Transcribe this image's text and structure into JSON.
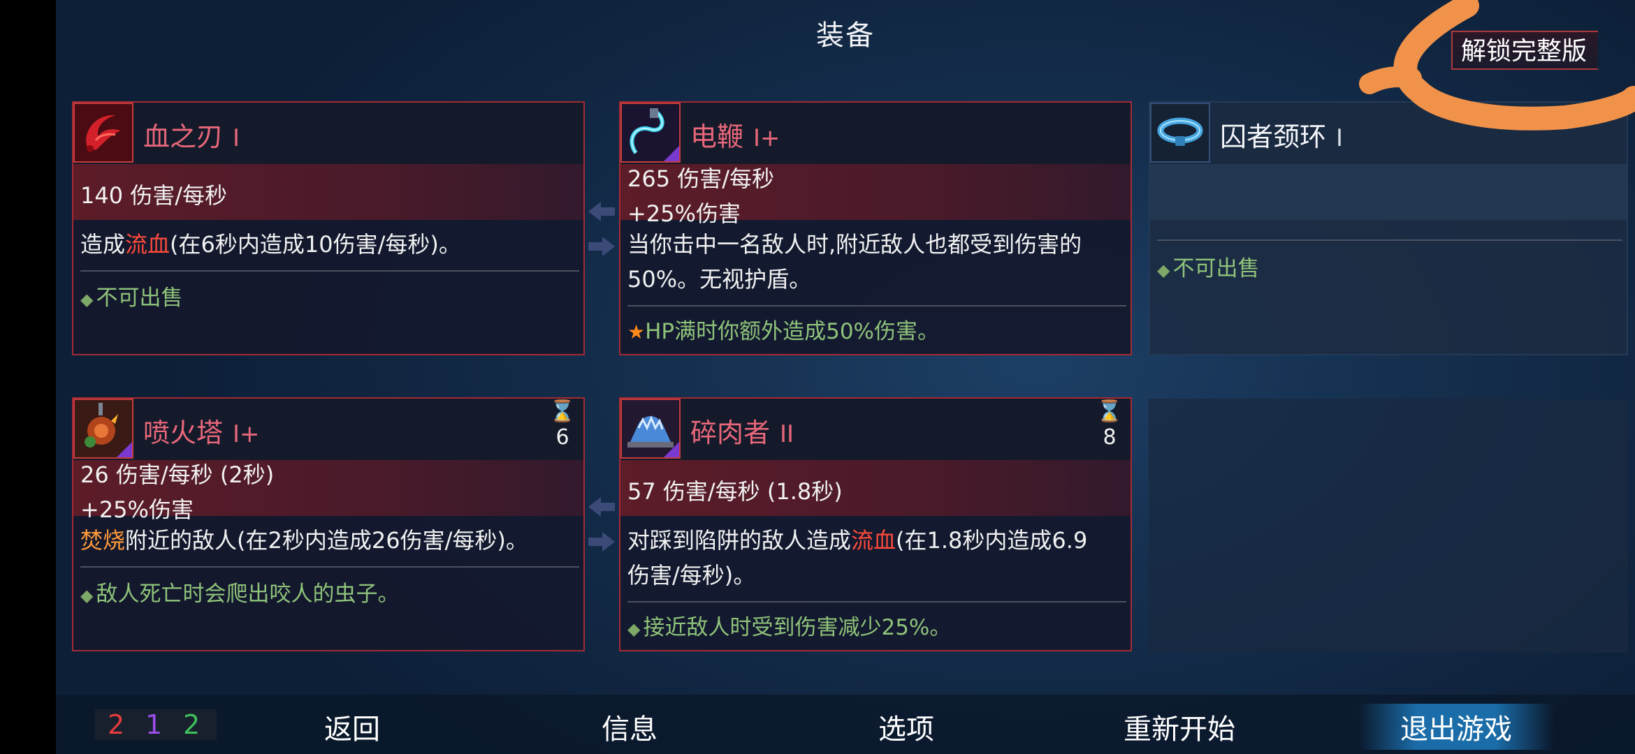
{
  "title": "装备",
  "unlock_label": "解锁完整版",
  "cards": {
    "blood_blade": {
      "name": "血之刃",
      "tier": "I",
      "dps": "140 伤害/每秒",
      "desc_pre": "造成",
      "desc_kw": "流血",
      "desc_post": "(在6秒内造成10伤害/每秒)。",
      "note": "不可出售"
    },
    "whip": {
      "name": "电鞭",
      "tier": "I+",
      "dps": "265 伤害/每秒",
      "bonus": "+25%伤害",
      "desc_line1": "当你击中一名敌人时,附近敌人也都受到伤害的",
      "desc_line2": "50%。无视护盾。",
      "note": "HP满时你额外造成50%伤害。"
    },
    "collar": {
      "name": "囚者颈环",
      "tier": "I",
      "note": "不可出售"
    },
    "flamethrower": {
      "name": "喷火塔",
      "tier": "I+",
      "timer": "6",
      "dps": "26 伤害/每秒 (2秒)",
      "bonus": "+25%伤害",
      "desc_kw": "焚烧",
      "desc_post": "附近的敌人(在2秒内造成26伤害/每秒)。",
      "note": "敌人死亡时会爬出咬人的虫子。"
    },
    "meat_grinder": {
      "name": "碎肉者",
      "tier": "II",
      "timer": "8",
      "dps": "57 伤害/每秒 (1.8秒)",
      "desc_pre": "对踩到陷阱的敌人造成",
      "desc_kw": "流血",
      "desc_post": "(在1.8秒内造成6.9",
      "desc_line2": "伤害/每秒)。",
      "note": "接近敌人时受到伤害减少25%。"
    }
  },
  "footer": {
    "counts": [
      "2",
      "1",
      "2"
    ],
    "count_colors": [
      "#e23b3b",
      "#9a4ee8",
      "#3fbf5a"
    ],
    "menu": [
      "返回",
      "信息",
      "选项",
      "重新开始",
      "退出游戏"
    ]
  },
  "colors": {
    "card_border": "#a52a34",
    "accent_orange": "#f0924a"
  },
  "icons": [
    "blood-blade-icon",
    "electric-whip-icon",
    "prisoner-collar-icon",
    "flamethrower-turret-icon",
    "meat-grinder-icon",
    "hourglass-icon"
  ]
}
